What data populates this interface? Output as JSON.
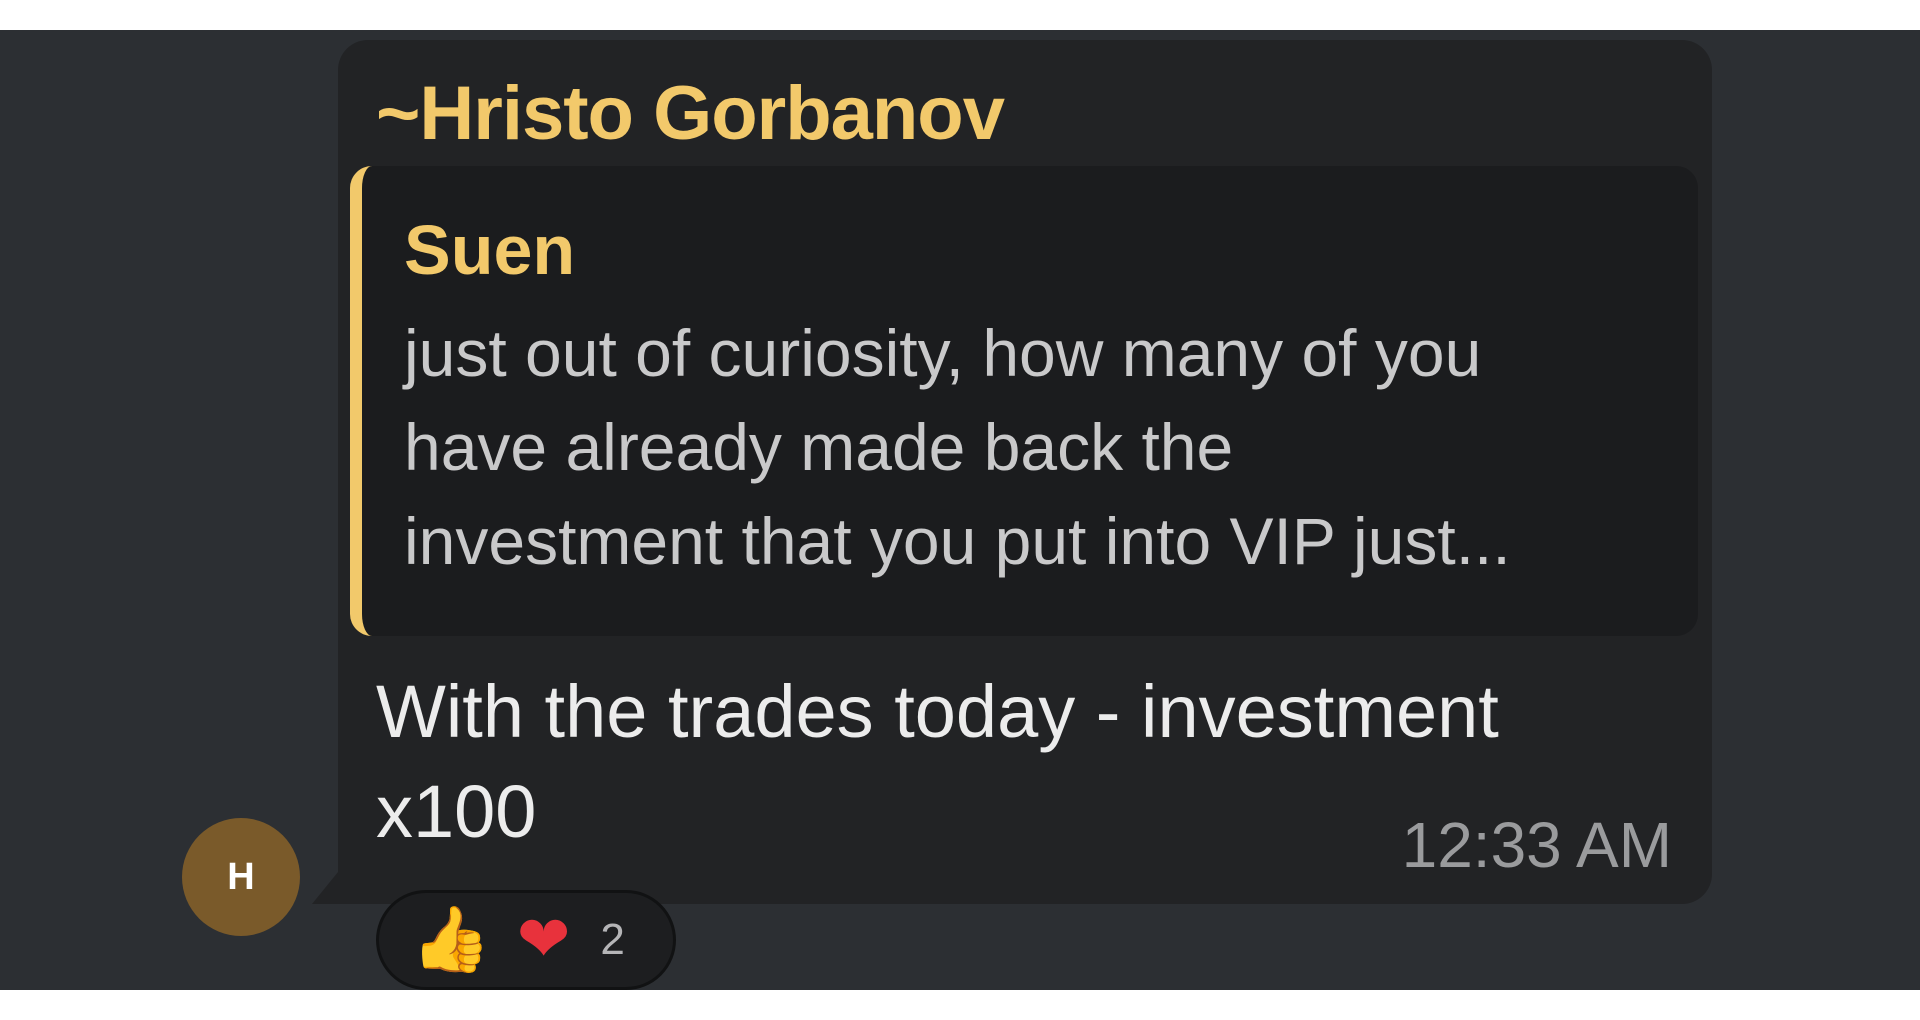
{
  "message": {
    "avatar_initial": "H",
    "sender": "~Hristo Gorbanov",
    "reply": {
      "author": "Suen",
      "lines": [
        "just out of curiosity, how many of you",
        "have already made back the",
        "investment that you put into VIP just..."
      ]
    },
    "text_lines": [
      "With the trades today - investment",
      "x100"
    ],
    "time": "12:33 AM",
    "reactions": {
      "items": [
        {
          "icon": "thumbs-up-icon",
          "glyph": "👍",
          "color": "#f3b83a"
        },
        {
          "icon": "heart-icon",
          "glyph": "❤",
          "color": "#e8323c"
        }
      ],
      "count": "2"
    }
  },
  "colors": {
    "background": "#2c2f33",
    "bubble": "#222325",
    "quote_background": "#1b1c1e",
    "accent": "#f2c96b",
    "avatar": "#7a5a2a"
  }
}
